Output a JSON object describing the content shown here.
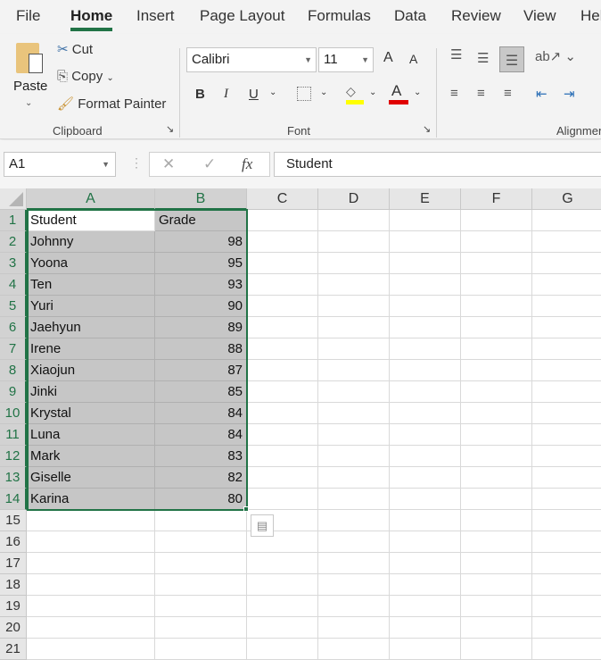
{
  "tabs": [
    "File",
    "Home",
    "Insert",
    "Page Layout",
    "Formulas",
    "Data",
    "Review",
    "View",
    "Help"
  ],
  "clipboard": {
    "paste": "Paste",
    "cut": "Cut",
    "copy": "Copy",
    "format_painter": "Format Painter",
    "group": "Clipboard"
  },
  "font": {
    "name": "Calibri",
    "size": "11",
    "bold": "B",
    "italic": "I",
    "underline": "U",
    "grow": "A",
    "shrink": "A",
    "color": "A",
    "group": "Font",
    "fill_color": "#ffff00",
    "font_color": "#e00000"
  },
  "alignment": {
    "group": "Alignment"
  },
  "formula_bar": {
    "name_box": "A1",
    "fx": "fx",
    "cancel": "✕",
    "enter": "✓",
    "content": "Student"
  },
  "columns": [
    "A",
    "B",
    "C",
    "D",
    "E",
    "F",
    "G"
  ],
  "rows": [
    "1",
    "2",
    "3",
    "4",
    "5",
    "6",
    "7",
    "8",
    "9",
    "10",
    "11",
    "12",
    "13",
    "14",
    "15",
    "16",
    "17",
    "18",
    "19",
    "20",
    "21"
  ],
  "table": {
    "headers": [
      "Student",
      "Grade"
    ],
    "data": [
      [
        "Johnny",
        "98"
      ],
      [
        "Yoona",
        "95"
      ],
      [
        "Ten",
        "93"
      ],
      [
        "Yuri",
        "90"
      ],
      [
        "Jaehyun",
        "89"
      ],
      [
        "Irene",
        "88"
      ],
      [
        "Xiaojun",
        "87"
      ],
      [
        "Jinki",
        "85"
      ],
      [
        "Krystal",
        "84"
      ],
      [
        "Luna",
        "84"
      ],
      [
        "Mark",
        "83"
      ],
      [
        "Giselle",
        "82"
      ],
      [
        "Karina",
        "80"
      ]
    ]
  }
}
